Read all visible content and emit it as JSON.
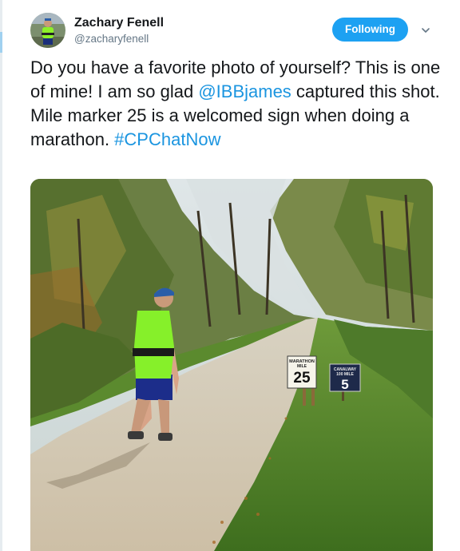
{
  "user": {
    "display_name": "Zachary Fenell",
    "handle": "@zacharyfenell",
    "avatar_icon": "runner-avatar"
  },
  "follow_button": {
    "label": "Following"
  },
  "menu": {
    "caret_icon": "chevron-down-icon"
  },
  "tweet": {
    "text_part1": "Do you have a favorite photo of yourself? This is one of mine! I am so glad ",
    "mention": "@IBBjames",
    "text_part2": " captured this shot. Mile marker 25 is a welcomed sign when doing a marathon. ",
    "hashtag": "#CPChatNow"
  },
  "photo": {
    "sign_left": {
      "line1": "MARATHON",
      "line2": "MILE",
      "number": "25"
    },
    "sign_right": {
      "line1": "CANALWAY",
      "line2": "100 MILE",
      "number": "5"
    }
  },
  "colors": {
    "accent": "#1da1f2",
    "link": "#1b95e0",
    "text": "#14171a",
    "muted": "#657786"
  }
}
